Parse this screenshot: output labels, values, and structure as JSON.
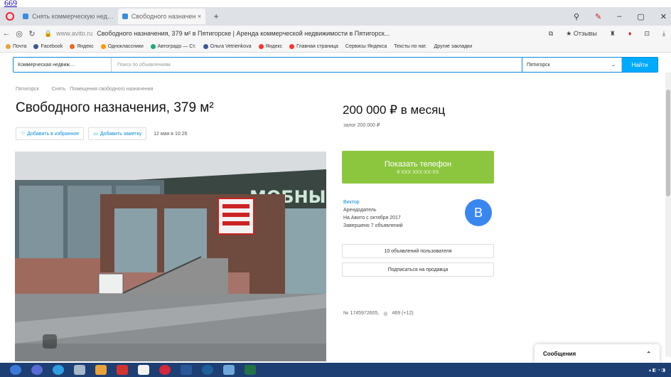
{
  "page_link": "669",
  "tabs": [
    {
      "label": "Снять коммерческую нед…",
      "active": false
    },
    {
      "label": "Свободного назначен ×",
      "active": true
    }
  ],
  "address_bar": {
    "host": "www.avito.ru",
    "page_title": "Свободного назначения, 379 м² в Пятигорске | Аренда коммерческой недвижимости в Пятигорск..."
  },
  "bookmarks": [
    "Почта",
    "Facebook",
    "Яндекс",
    "Одноклассники",
    "Автоградо — Ст.",
    "Ольга Vetrienkova",
    "Яндекс",
    "Главная страница",
    "Сервисы Яндекса",
    "Тексты по нат.",
    "Другие закладки"
  ],
  "search": {
    "category": "Коммерческая недвиж…",
    "placeholder": "Поиск по объявлениям",
    "city": "Пятигорск",
    "button": "Найти"
  },
  "breadcrumbs": [
    "Пятигорск",
    "Снять",
    "Помещения свободного назначения"
  ],
  "listing": {
    "title": "Свободного назначения, 379 м²",
    "price": "200 000 ₽ в месяц",
    "deposit": "залог 200 000 ₽",
    "favorite": "Добавить в избранное",
    "note": "Добавить заметку",
    "date": "12 мая в 10:26",
    "photo_sign": "МОБНЫЕ"
  },
  "contact": {
    "phone_label": "Показать телефон",
    "phone_number": "8 XXX XXX-XX-XX",
    "seller_name": "Виктор",
    "seller_role": "Арендодатель",
    "seller_since": "На Авито с октября 2017",
    "seller_completed": "Завершено 7 объявлений",
    "avatar_letter": "B",
    "all_ads": "10 объявлений пользователя",
    "subscribe": "Подписаться на продавца"
  },
  "ad_meta": {
    "id": "№ 1745972605,",
    "views": "469 (+12)"
  },
  "messages": {
    "label": "Сообщения"
  },
  "colors": {
    "accent": "#00aaff",
    "phone_green": "#8cc63f",
    "avatar_blue": "#3a86f0",
    "taskbar": "#1d3f73"
  }
}
